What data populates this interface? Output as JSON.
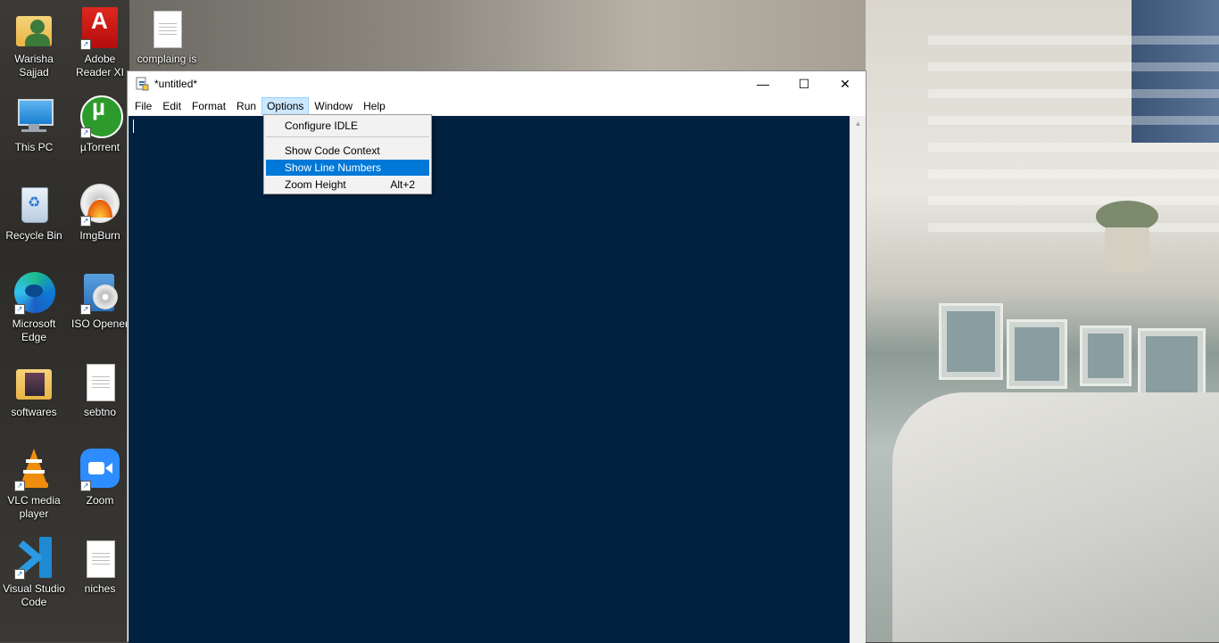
{
  "desktop": {
    "icons": [
      {
        "label": "Warisha\nSajjad",
        "icon": "user-folder-icon"
      },
      {
        "label": "Adobe\nReader XI",
        "icon": "adobe-reader-icon"
      },
      {
        "label": "complaing is",
        "icon": "text-document-icon"
      },
      {
        "label": "This PC",
        "icon": "computer-icon"
      },
      {
        "label": "µTorrent",
        "icon": "utorrent-icon"
      },
      {
        "label": "Recycle Bin",
        "icon": "recycle-bin-icon"
      },
      {
        "label": "ImgBurn",
        "icon": "imgburn-icon"
      },
      {
        "label": "Microsoft\nEdge",
        "icon": "edge-icon"
      },
      {
        "label": "ISO Opener",
        "icon": "iso-opener-icon"
      },
      {
        "label": "softwares",
        "icon": "folder-icon"
      },
      {
        "label": "sebtno",
        "icon": "text-document-icon"
      },
      {
        "label": "VLC media\nplayer",
        "icon": "vlc-icon"
      },
      {
        "label": "Zoom",
        "icon": "zoom-icon"
      },
      {
        "label": "Visual Studio\nCode",
        "icon": "vscode-icon"
      },
      {
        "label": "niches",
        "icon": "text-document-icon"
      }
    ]
  },
  "window": {
    "title": "*untitled*",
    "controls": {
      "minimize": "—",
      "maximize": "☐",
      "close": "✕"
    }
  },
  "menubar": {
    "items": [
      "File",
      "Edit",
      "Format",
      "Run",
      "Options",
      "Window",
      "Help"
    ],
    "open_menu": "Options"
  },
  "options_menu": {
    "items": [
      {
        "label": "Configure IDLE",
        "accel": ""
      },
      {
        "label": "Show Code Context",
        "accel": ""
      },
      {
        "label": "Show Line Numbers",
        "accel": "",
        "highlighted": true
      },
      {
        "label": "Zoom Height",
        "accel": "Alt+2"
      }
    ]
  },
  "colors": {
    "editor_background": "#00213f",
    "menu_highlight": "#0078d7"
  }
}
